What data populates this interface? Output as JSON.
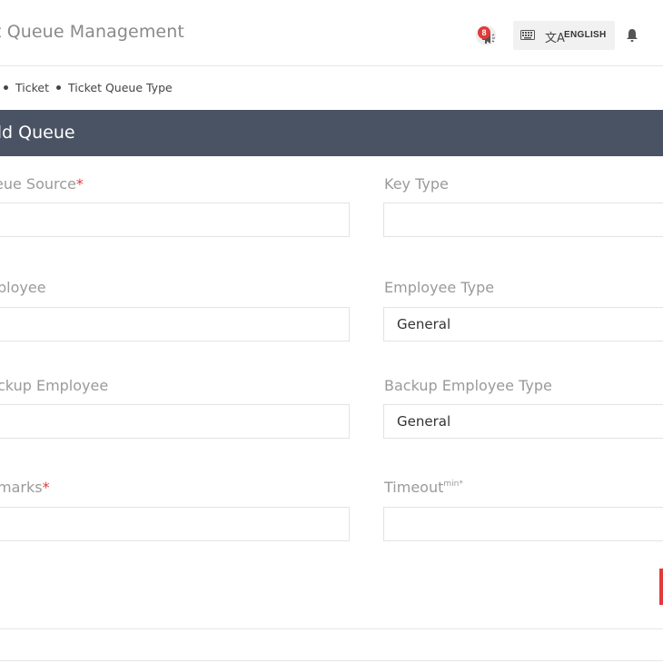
{
  "header": {
    "title": "t Queue Management",
    "notification_count": "8",
    "language_label": "ENGLISH",
    "translate_glyph": "文A"
  },
  "breadcrumb": {
    "items": [
      "Ticket",
      "Ticket Queue Type"
    ]
  },
  "panel": {
    "title": "dd Queue"
  },
  "form": {
    "queue_source": {
      "label": "eue Source",
      "required": "*",
      "value": ""
    },
    "key_type": {
      "label": "Key Type",
      "value": ""
    },
    "employee": {
      "label": "ployee",
      "value": ""
    },
    "employee_type": {
      "label": "Employee Type",
      "value": "General"
    },
    "backup_employee": {
      "label": "ckup Employee",
      "value": ""
    },
    "backup_employee_type": {
      "label": "Backup Employee Type",
      "value": "General"
    },
    "remarks": {
      "label": "marks",
      "required": "*",
      "value": ""
    },
    "timeout": {
      "label": "Timeout",
      "unit": "min",
      "required": "*",
      "value": ""
    }
  },
  "colors": {
    "accent": "#e23a3a",
    "panel_header": "#4a5363",
    "label_text": "#9a9a9a"
  }
}
